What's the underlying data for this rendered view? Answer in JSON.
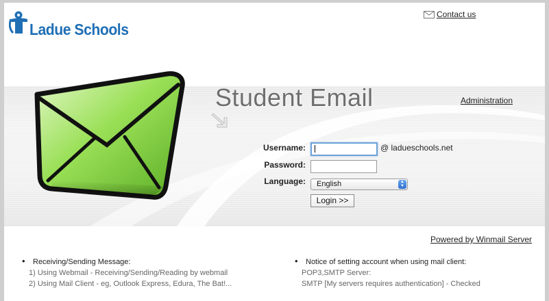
{
  "header": {
    "logo_text": "Ladue Schools",
    "contact_label": "Contact us"
  },
  "main": {
    "title": "Student Email",
    "admin_link": "Administration"
  },
  "form": {
    "username_label": "Username:",
    "username_value": "",
    "domain_suffix": "@ ladueschools.net",
    "password_label": "Password:",
    "language_label": "Language:",
    "language_selected": "English",
    "login_label": "Login >>"
  },
  "footer": {
    "powered_by": "Powered by Winmail Server"
  },
  "info_left": {
    "heading": "Receiving/Sending Message:",
    "lines": [
      "1) Using Webmail - Receiving/Sending/Reading by webmail",
      "2) Using Mail Client - eg, Outlook Express, Edura, The Bat!..."
    ]
  },
  "info_right": {
    "heading": "Notice of setting account when using mail client:",
    "lines": [
      "POP3,SMTP Server:",
      "SMTP [My servers requires authentication] - Checked"
    ]
  },
  "colors": {
    "brand_blue": "#1f6fb5",
    "envelope_green": "#7fd23c",
    "title_gray": "#6e6e6e"
  },
  "icons": {
    "logo": "ladue-logo-icon",
    "contact": "mail-icon",
    "envelope": "envelope-illustration",
    "arrow": "arrow-icon",
    "select": "select-arrows-icon"
  }
}
